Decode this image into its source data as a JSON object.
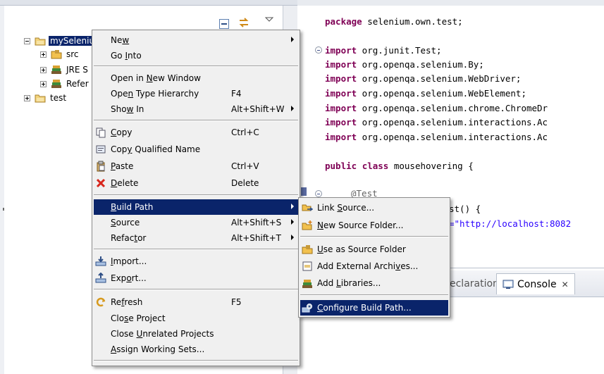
{
  "package_explorer": {
    "tree": [
      {
        "label": "mySelenium",
        "expanded": true,
        "selected": true
      },
      {
        "label": "src",
        "expanded": false
      },
      {
        "label": "JRE S",
        "expanded": false
      },
      {
        "label": "Refer",
        "expanded": false
      },
      {
        "label": "test",
        "expanded": false
      }
    ]
  },
  "context_menu": {
    "items": [
      {
        "key": "new",
        "pre": "Ne",
        "u": "w",
        "post": "",
        "shortcut": "",
        "submenu": true
      },
      {
        "key": "go_into",
        "pre": "Go ",
        "u": "I",
        "post": "nto",
        "shortcut": "",
        "submenu": false
      },
      {
        "key": "open_new_window",
        "pre": "Open in ",
        "u": "N",
        "post": "ew Window",
        "shortcut": "",
        "submenu": false
      },
      {
        "key": "open_type_hierarchy",
        "pre": "Ope",
        "u": "n",
        "post": " Type Hierarchy",
        "shortcut": "F4",
        "submenu": false
      },
      {
        "key": "show_in",
        "pre": "Sho",
        "u": "w",
        "post": " In",
        "shortcut": "Alt+Shift+W",
        "submenu": true
      },
      {
        "key": "copy",
        "pre": "",
        "u": "C",
        "post": "opy",
        "shortcut": "Ctrl+C",
        "submenu": false
      },
      {
        "key": "copy_qualified_name",
        "pre": "Cop",
        "u": "y",
        "post": " Qualified Name",
        "shortcut": "",
        "submenu": false
      },
      {
        "key": "paste",
        "pre": "",
        "u": "P",
        "post": "aste",
        "shortcut": "Ctrl+V",
        "submenu": false
      },
      {
        "key": "delete",
        "pre": "",
        "u": "D",
        "post": "elete",
        "shortcut": "Delete",
        "submenu": false
      },
      {
        "key": "build_path",
        "pre": "",
        "u": "B",
        "post": "uild Path",
        "shortcut": "",
        "submenu": true
      },
      {
        "key": "source",
        "pre": "",
        "u": "S",
        "post": "ource",
        "shortcut": "Alt+Shift+S",
        "submenu": true
      },
      {
        "key": "refactor",
        "pre": "Refac",
        "u": "t",
        "post": "or",
        "shortcut": "Alt+Shift+T",
        "submenu": true
      },
      {
        "key": "import",
        "pre": "",
        "u": "I",
        "post": "mport...",
        "shortcut": "",
        "submenu": false
      },
      {
        "key": "export",
        "pre": "Exp",
        "u": "o",
        "post": "rt...",
        "shortcut": "",
        "submenu": false
      },
      {
        "key": "refresh",
        "pre": "Re",
        "u": "f",
        "post": "resh",
        "shortcut": "F5",
        "submenu": false
      },
      {
        "key": "close_project",
        "pre": "Clo",
        "u": "s",
        "post": "e Project",
        "shortcut": "",
        "submenu": false
      },
      {
        "key": "close_unrelated",
        "pre": "Close ",
        "u": "U",
        "post": "nrelated Projects",
        "shortcut": "",
        "submenu": false
      },
      {
        "key": "assign_working_sets",
        "pre": "",
        "u": "A",
        "post": "ssign Working Sets...",
        "shortcut": "",
        "submenu": false
      }
    ]
  },
  "build_path_submenu": {
    "items": [
      {
        "key": "link_source",
        "pre": "Link ",
        "u": "S",
        "post": "ource..."
      },
      {
        "key": "new_source_folder",
        "pre": "",
        "u": "N",
        "post": "ew Source Folder..."
      },
      {
        "key": "use_as_source_folder",
        "pre": "",
        "u": "U",
        "post": "se as Source Folder"
      },
      {
        "key": "add_external_archives",
        "pre": "Add External Archi",
        "u": "v",
        "post": "es..."
      },
      {
        "key": "add_libraries",
        "pre": "Add ",
        "u": "L",
        "post": "ibraries..."
      },
      {
        "key": "configure_build_path",
        "pre": "",
        "u": "C",
        "post": "onfigure Build Path..."
      }
    ]
  },
  "editor": {
    "line1_kw": "package",
    "line1_rest": " selenium.own.test;",
    "imports_kw": "import",
    "imports": [
      " org.junit.Test;",
      " org.openqa.selenium.By;",
      " org.openqa.selenium.WebDriver;",
      " org.openqa.selenium.WebElement;",
      " org.openqa.selenium.chrome.ChromeDr",
      " org.openqa.selenium.interactions.Ac",
      " org.openqa.selenium.interactions.Ac"
    ],
    "class_kw1": "public",
    "class_kw2": "class",
    "class_name": " mousehovering {",
    "annotation": "@Test",
    "method_frag": "st() {",
    "string_frag": "=\"http://localhost:8082"
  },
  "bottom_views": {
    "declaration_tab": "eclaration",
    "console_tab": "Console",
    "close_glyph": "✕"
  },
  "colors": {
    "selection": "#0a246a",
    "keyword": "#7f0055",
    "string": "#2a00ff"
  }
}
